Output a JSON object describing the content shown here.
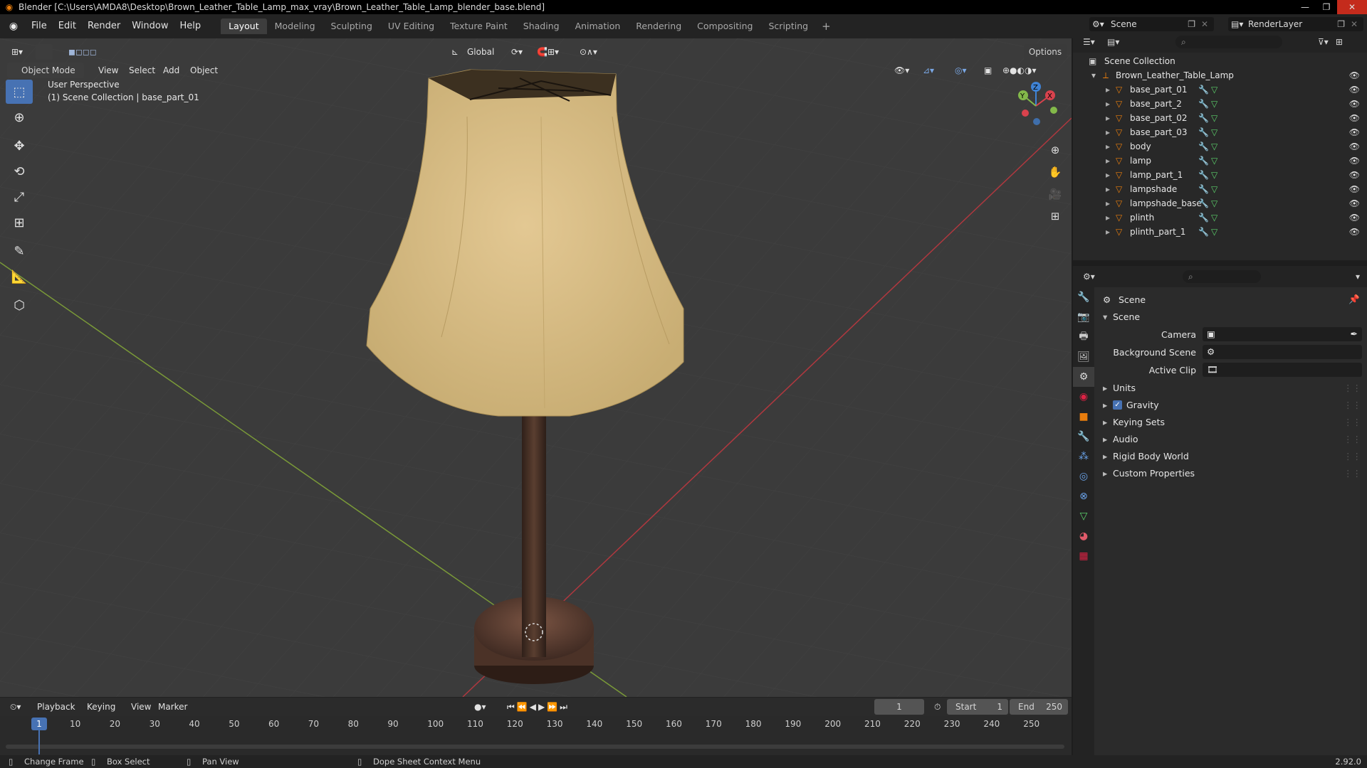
{
  "titlebar": {
    "title": "Blender [C:\\Users\\AMDA8\\Desktop\\Brown_Leather_Table_Lamp_max_vray\\Brown_Leather_Table_Lamp_blender_base.blend]",
    "minimize": "—",
    "maximize": "❐",
    "close": "✕"
  },
  "menubar": {
    "items": [
      "File",
      "Edit",
      "Render",
      "Window",
      "Help"
    ],
    "workspaces": [
      "Layout",
      "Modeling",
      "Sculpting",
      "UV Editing",
      "Texture Paint",
      "Shading",
      "Animation",
      "Rendering",
      "Compositing",
      "Scripting"
    ],
    "active_workspace": "Layout",
    "scene": "Scene",
    "view_layer": "RenderLayer"
  },
  "viewport": {
    "mode": "Object Mode",
    "menus": [
      "View",
      "Select",
      "Add",
      "Object"
    ],
    "transform_orientation": "Global",
    "options": "Options",
    "perspective": "User Perspective",
    "collection_info": "(1) Scene Collection | base_part_01",
    "gizmo": {
      "x": "X",
      "y": "Y",
      "z": "Z"
    }
  },
  "timeline": {
    "menus": [
      "Playback",
      "Keying",
      "View",
      "Marker"
    ],
    "current_frame": "1",
    "start_label": "Start",
    "start": "1",
    "end_label": "End",
    "end": "250",
    "ticks": [
      "10",
      "20",
      "30",
      "40",
      "50",
      "60",
      "70",
      "80",
      "90",
      "100",
      "110",
      "120",
      "130",
      "140",
      "150",
      "160",
      "170",
      "180",
      "190",
      "200",
      "210",
      "220",
      "230",
      "240",
      "250"
    ],
    "cursor": "1"
  },
  "statusbar": {
    "items": [
      "Change Frame",
      "Box Select",
      "Pan View",
      "Dope Sheet Context Menu"
    ],
    "version": "2.92.0"
  },
  "outliner": {
    "root": "Scene Collection",
    "collection": "Brown_Leather_Table_Lamp",
    "objects": [
      "base_part_01",
      "base_part_2",
      "base_part_02",
      "base_part_03",
      "body",
      "lamp",
      "lamp_part_1",
      "lampshade",
      "lampshade_base",
      "plinth",
      "plinth_part_1"
    ]
  },
  "properties": {
    "context": "Scene",
    "panel": "Scene",
    "camera_label": "Camera",
    "bg_scene_label": "Background Scene",
    "active_clip_label": "Active Clip",
    "subpanels": [
      "Units",
      "Gravity",
      "Keying Sets",
      "Audio",
      "Rigid Body World",
      "Custom Properties"
    ]
  },
  "colors": {
    "accent": "#4772b3",
    "orange": "#e87d0d",
    "x_axis": "#d9424d",
    "y_axis": "#83b94a",
    "z_axis": "#3f83d6"
  }
}
